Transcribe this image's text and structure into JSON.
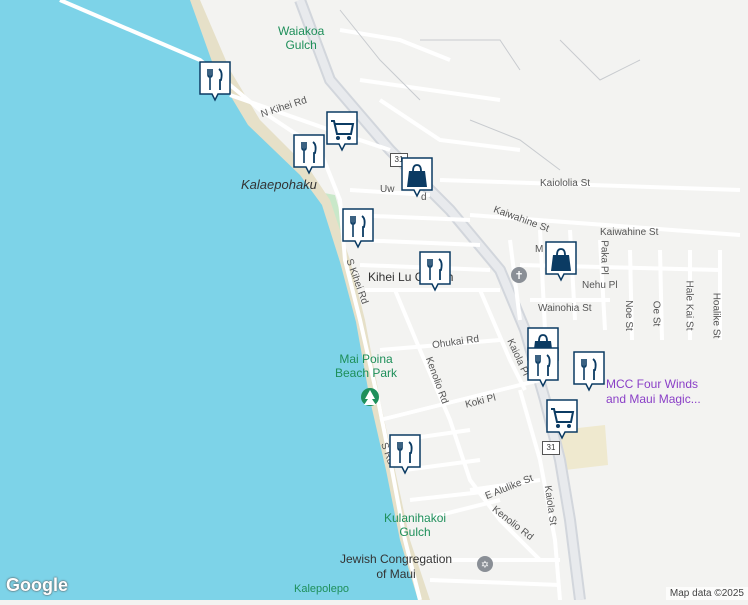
{
  "colors": {
    "ocean": "#7dd3e8",
    "land": "#f3f3f1",
    "beach": "#e6e0c8",
    "highway": "#dadde2",
    "road": "#ffffff",
    "marker": "#0b3b63",
    "green": "#c9e8c9"
  },
  "labels": {
    "waiakoa_gulch": "Waiakoa\nGulch",
    "n_kihei_rd": "N Kihei Rd",
    "kalaepohaku": "Kalaepohaku",
    "uw_rd": "Uw",
    "rd_fragment": "d",
    "kaiololia_st": "Kaiololia St",
    "kaiwahine_st_1": "Kaiwahine St",
    "kaiwahine_st_2": "Kaiwahine St",
    "kihei_church": "Kihei Lu      Church",
    "s_kihei_rd": "S Kihei Rd",
    "s_kihei_rd_2": "S       Rd",
    "paka_pl": "Paka Pl",
    "nehu_pl": "Nehu Pl",
    "m_fragment": "M",
    "wainohia_st": "Wainohia St",
    "noe_st": "Noe St",
    "oe_st": "Oe St",
    "hale_kai_st": "Hale Kai St",
    "hoalike_st": "Hoalike St",
    "ohukai_rd": "Ohukai Rd",
    "kaiola_pl": "Kaiola Pl",
    "mai_poina": "Mai Poina\nBeach Park",
    "kenolio_rd": "Kenolio Rd",
    "koki_pl": "Koki Pl",
    "mcc_four_winds": "MCC Four Winds\nand Maui Magic...",
    "e_alulike_st": "E Alulike St",
    "kaiola_st": "Kaiola St",
    "kenolio_rd_2": "Kenolio Rd",
    "kulanihakoi_gulch": "Kulanihakoi\nGulch",
    "jewish_congregation": "Jewish Congregation\nof Maui",
    "kalepolepo": "Kalepolepo"
  },
  "route_shields": {
    "r31_top": "31",
    "r31_bottom": "31"
  },
  "markers": [
    {
      "icon": "restaurant-icon"
    },
    {
      "icon": "shopping-cart-icon"
    },
    {
      "icon": "restaurant-icon"
    },
    {
      "icon": "shopping-bag-icon"
    },
    {
      "icon": "restaurant-icon"
    },
    {
      "icon": "restaurant-icon"
    },
    {
      "icon": "shopping-bag-icon"
    },
    {
      "icon": "shopping-bag-icon"
    },
    {
      "icon": "restaurant-icon"
    },
    {
      "icon": "restaurant-icon"
    },
    {
      "icon": "shopping-cart-icon"
    },
    {
      "icon": "restaurant-icon"
    }
  ],
  "footer": {
    "logo": "Google",
    "attribution": "Map data ©2025"
  }
}
